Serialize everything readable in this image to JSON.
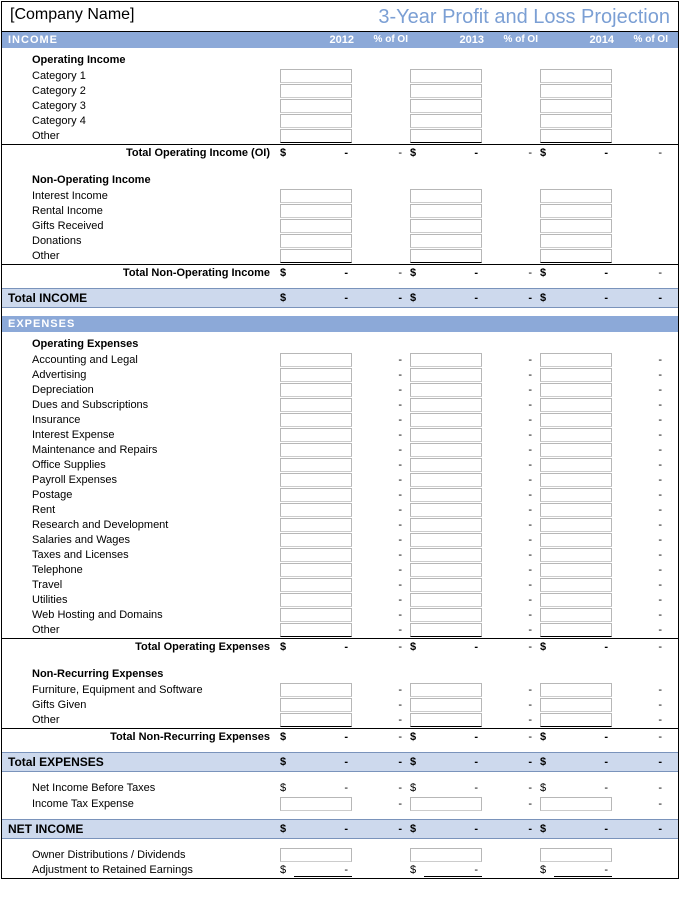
{
  "header": {
    "company": "[Company Name]",
    "title": "3-Year Profit and Loss Projection"
  },
  "years": [
    "2012",
    "2013",
    "2014"
  ],
  "pctLabel": "% of OI",
  "dash": "-",
  "currency": "$",
  "income": {
    "bar": "INCOME",
    "operating": {
      "head": "Operating Income",
      "items": [
        "Category 1",
        "Category 2",
        "Category 3",
        "Category 4",
        "Other"
      ],
      "total": "Total Operating Income (OI)"
    },
    "nonOperating": {
      "head": "Non-Operating Income",
      "items": [
        "Interest Income",
        "Rental Income",
        "Gifts Received",
        "Donations",
        "Other"
      ],
      "total": "Total Non-Operating Income"
    },
    "total": "Total INCOME"
  },
  "expenses": {
    "bar": "EXPENSES",
    "operating": {
      "head": "Operating Expenses",
      "items": [
        "Accounting and Legal",
        "Advertising",
        "Depreciation",
        "Dues and Subscriptions",
        "Insurance",
        "Interest Expense",
        "Maintenance and Repairs",
        "Office Supplies",
        "Payroll Expenses",
        "Postage",
        "Rent",
        "Research and Development",
        "Salaries and Wages",
        "Taxes and Licenses",
        "Telephone",
        "Travel",
        "Utilities",
        "Web Hosting and Domains",
        "Other"
      ],
      "total": "Total Operating Expenses"
    },
    "nonRecurring": {
      "head": "Non-Recurring Expenses",
      "items": [
        "Furniture, Equipment and Software",
        "Gifts Given",
        "Other"
      ],
      "total": "Total Non-Recurring Expenses"
    },
    "total": "Total EXPENSES"
  },
  "netIncome": {
    "before": "Net Income Before Taxes",
    "taxExpense": "Income Tax Expense",
    "bar": "NET INCOME"
  },
  "footer": {
    "dist": "Owner Distributions / Dividends",
    "adj": "Adjustment to Retained Earnings"
  }
}
